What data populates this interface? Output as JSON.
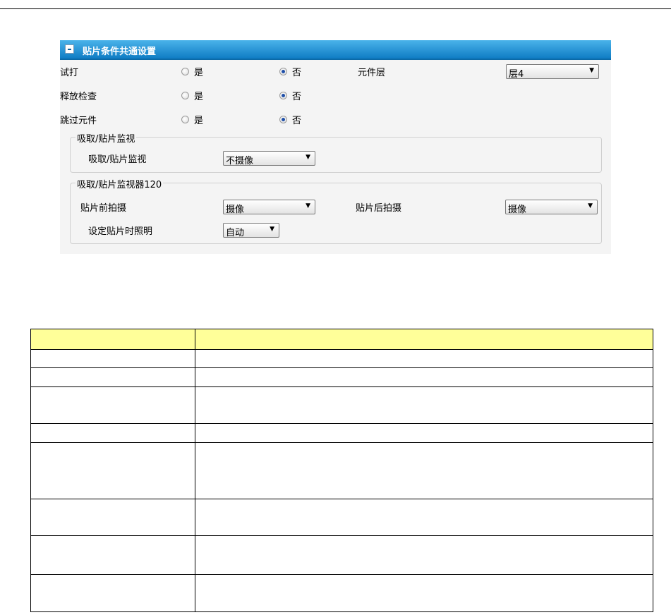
{
  "panel": {
    "title": "贴片条件共通设置",
    "rows": [
      {
        "label": "试打",
        "yes": "是",
        "no": "否"
      },
      {
        "label": "释放检查",
        "yes": "是",
        "no": "否"
      },
      {
        "label": "跳过元件",
        "yes": "是",
        "no": "否"
      }
    ],
    "component_layer": {
      "label": "元件层",
      "value": "层4"
    },
    "monitor_group": {
      "title": "吸取/贴片监视",
      "row_label": "吸取/贴片监视",
      "value": "不摄像"
    },
    "monitor120_group": {
      "title": "吸取/贴片监视器120",
      "before_label": "贴片前拍摄",
      "before_value": "摄像",
      "after_label": "贴片后拍摄",
      "after_value": "摄像",
      "lighting_label": "设定贴片时照明",
      "lighting_value": "自动"
    }
  },
  "colors": {
    "header_start": "#4ab3ea",
    "header_end": "#0f7cc4",
    "table_header": "#ffff99",
    "radio_selected": "#1f4fa8"
  },
  "icons": [
    "collapse-icon",
    "dropdown-arrow-icon",
    "radio-icon"
  ]
}
